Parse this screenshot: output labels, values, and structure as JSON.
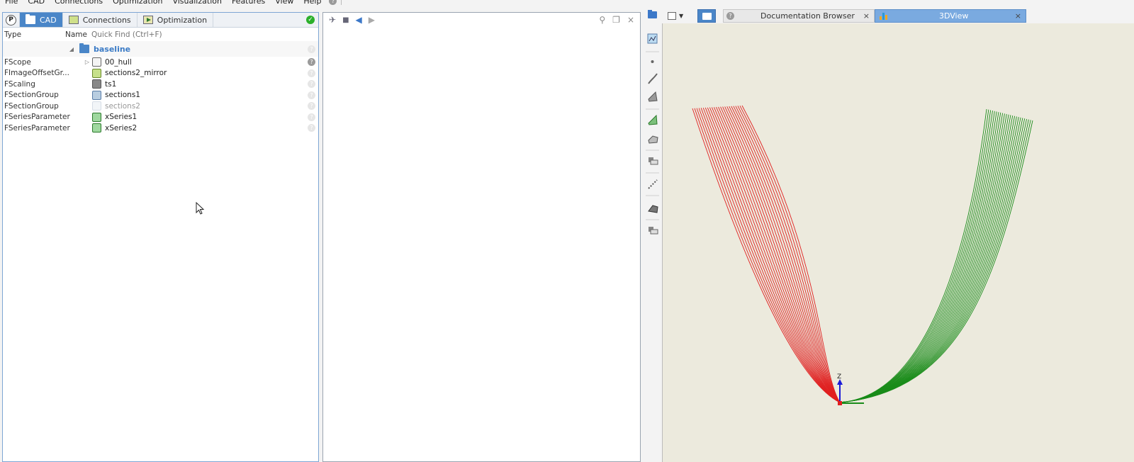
{
  "menu": [
    "File",
    "CAD",
    "Connections",
    "Optimization",
    "Visualization",
    "Features",
    "View",
    "Help"
  ],
  "left_panel": {
    "tabs": [
      {
        "label": "CAD",
        "icon": "folder-icon",
        "active": true
      },
      {
        "label": "Connections",
        "icon": "monitor-icon",
        "active": false
      },
      {
        "label": "Optimization",
        "icon": "play-icon",
        "active": false
      }
    ],
    "p_badge": "P",
    "status_icon": "check-circle-icon",
    "columns": {
      "type": "Type",
      "name": "Name"
    },
    "quick_find": {
      "placeholder": "Quick Find (Ctrl+F)",
      "value": ""
    },
    "root": {
      "label": "baseline",
      "icon": "folder-icon"
    },
    "rows": [
      {
        "type": "FScope",
        "name": "00_hull",
        "icon": "scope-icon",
        "expandable": true,
        "muted": false
      },
      {
        "type": "FImageOffsetGr...",
        "name": "sections2_mirror",
        "icon": "image-offset-group-icon",
        "expandable": false,
        "muted": false
      },
      {
        "type": "FScaling",
        "name": "ts1",
        "icon": "scaling-icon",
        "expandable": false,
        "muted": false
      },
      {
        "type": "FSectionGroup",
        "name": "sections1",
        "icon": "section-group-icon",
        "expandable": false,
        "muted": false
      },
      {
        "type": "FSectionGroup",
        "name": "sections2",
        "icon": "section-group-icon",
        "expandable": false,
        "muted": true
      },
      {
        "type": "FSeriesParameter",
        "name": "xSeries1",
        "icon": "series-parameter-icon",
        "expandable": false,
        "muted": false
      },
      {
        "type": "FSeriesParameter",
        "name": "xSeries2",
        "icon": "series-parameter-icon",
        "expandable": false,
        "muted": false
      }
    ]
  },
  "right_tabs": {
    "doc": {
      "label": "Documentation Browser",
      "icon": "help-icon"
    },
    "view3d": {
      "label": "3DView",
      "icon": "chart-icon"
    },
    "close": "×"
  },
  "view3d": {
    "axis_label": "Z",
    "background": "#eceadd",
    "curve_colors": {
      "left": "#e02020",
      "right": "#1a8c1a"
    },
    "curve_count_per_side": 24
  },
  "colors": {
    "accent": "#4a86c8",
    "ok": "#2bb02b"
  }
}
